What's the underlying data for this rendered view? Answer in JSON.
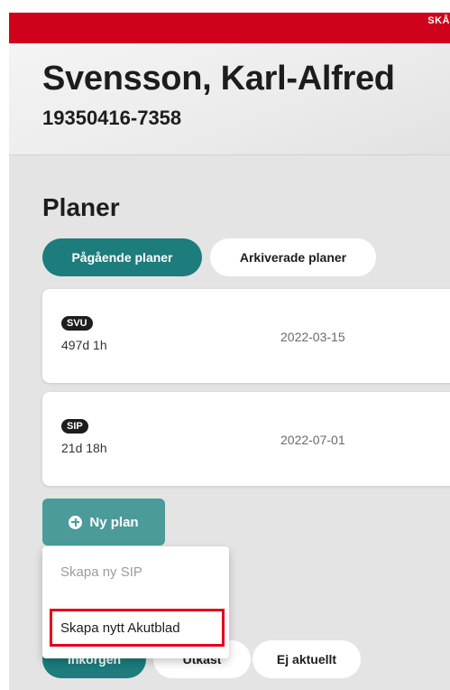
{
  "header": {
    "brand": "SKÅ",
    "patient_name": "Svensson, Karl-Alfred",
    "patient_id": "19350416-7358"
  },
  "plans": {
    "title": "Planer",
    "tabs": [
      {
        "label": "Pågående planer",
        "active": true
      },
      {
        "label": "Arkiverade planer",
        "active": false
      }
    ],
    "items": [
      {
        "badge": "SVU",
        "duration": "497d 1h",
        "date": "2022-03-15"
      },
      {
        "badge": "SIP",
        "duration": "21d 18h",
        "date": "2022-07-01"
      }
    ],
    "new_plan_label": "Ny plan",
    "dropdown": [
      {
        "label": "Skapa ny SIP",
        "disabled": true
      },
      {
        "label": "Skapa nytt Akutblad",
        "disabled": false
      }
    ]
  },
  "filters": {
    "items": [
      {
        "label": "Inkorgen",
        "active": true
      },
      {
        "label": "Utkast",
        "active": false
      },
      {
        "label": "Ej aktuellt",
        "active": false
      }
    ]
  },
  "colors": {
    "brand_red": "#d0021b",
    "teal": "#1d7c7c",
    "highlight": "#e0001a"
  }
}
